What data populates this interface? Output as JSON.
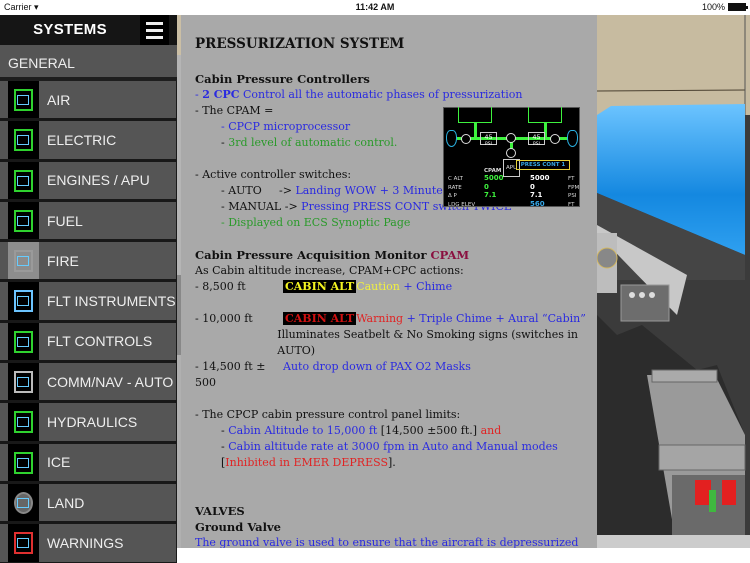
{
  "status_bar": {
    "carrier": "Carrier",
    "wifi_icon": "wifi-icon",
    "time": "11:42 AM",
    "battery": "100%",
    "battery_icon": "battery-icon"
  },
  "sidebar": {
    "title": "SYSTEMS",
    "menu_icon": "hamburger-menu-icon",
    "general_label": "GENERAL",
    "items": [
      {
        "label": "AIR",
        "icon": "air-system-thumbnail-icon"
      },
      {
        "label": "ELECTRIC",
        "icon": "electric-system-thumbnail-icon"
      },
      {
        "label": "ENGINES / APU",
        "icon": "engines-apu-thumbnail-icon"
      },
      {
        "label": "FUEL",
        "icon": "fuel-system-thumbnail-icon"
      },
      {
        "label": "FIRE",
        "icon": "fire-system-thumbnail-icon"
      },
      {
        "label": "FLT INSTRUMENTS",
        "icon": "flight-instruments-thumbnail-icon"
      },
      {
        "label": "FLT CONTROLS",
        "icon": "flight-controls-thumbnail-icon"
      },
      {
        "label": "COMM/NAV - AUTO",
        "icon": "comm-nav-thumbnail-icon"
      },
      {
        "label": "HYDRAULICS",
        "icon": "hydraulics-thumbnail-icon"
      },
      {
        "label": "ICE",
        "icon": "ice-thumbnail-icon"
      },
      {
        "label": "LAND",
        "icon": "landing-gear-thumbnail-icon"
      },
      {
        "label": "WARNINGS",
        "icon": "warnings-thumbnail-icon"
      }
    ]
  },
  "content": {
    "title": "PRESSURIZATION SYSTEM",
    "cpc_section": {
      "heading": "Cabin Pressure Controllers",
      "line1_prefix": "- ",
      "line1_bold": "2 CPC",
      "line1_rest": " Control all the automatic phases of pressurization",
      "line2": "- The CPAM =",
      "line3": "- CPCP microprocessor",
      "line4": "- 3rd level of automatic control.",
      "switches_label": "- Active controller switches:",
      "auto_key": "- AUTO",
      "auto_arrow": "->",
      "auto_value": "Landing WOW + 3 Minutes",
      "manual_key": "- MANUAL",
      "manual_arrow": "->",
      "manual_value": "Pressing PRESS CONT switch TWICE",
      "ecs_note": "- Displayed on ECS Synoptic Page"
    },
    "ecs_display": {
      "psi_left": "45",
      "psi_right": "45",
      "psi_unit": "PSI",
      "apu": "APU",
      "cpam_label": "CPAM",
      "press_cont": "PRESS CONT 1",
      "rows": [
        {
          "label": "C ALT",
          "cpam": "5000",
          "cont": "5000",
          "unit": "FT"
        },
        {
          "label": "RATE",
          "cpam": "0",
          "cont": "0",
          "unit": "FPM"
        },
        {
          "label": "Δ P",
          "cpam": "7.1",
          "cont": "7.1",
          "unit": "PSI"
        },
        {
          "label": "LDG ELEV",
          "cpam": "",
          "cont": "560",
          "unit": "FT"
        }
      ]
    },
    "cpam_section": {
      "heading": "Cabin Pressure Acquisition Monitor ",
      "heading_highlight": "CPAM",
      "intro": "As Cabin altitude increase, CPAM+CPC actions:",
      "r1_key": "- 8,500 ft",
      "r1_tag": "CABIN ALT",
      "r1_level": "Caution",
      "r1_rest": " + Chime",
      "r2_key": "- 10,000 ft",
      "r2_tag": "CABIN ALT",
      "r2_level": "Warning",
      "r2_rest": " + Triple Chime + Aural “Cabin”",
      "r2_note": "Illuminates Seatbelt & No Smoking signs (switches in AUTO)",
      "r3_key": "- 14,500 ft ± 500",
      "r3_value": "Auto drop down of PAX O2 Masks"
    },
    "limits_section": {
      "intro": "- The CPCP cabin pressure control panel limits:",
      "l1_dash": "- ",
      "l1_blue": "Cabin Altitude to 15,000 ft",
      "l1_black": " [14,500 ±500 ft.] ",
      "l1_red": "and",
      "l2_dash": "- ",
      "l2_blue": "Cabin altitude rate at 3000 fpm in Auto and Manual modes",
      "l2_black": " [",
      "l2_red": "Inhibited in EMER DEPRESS",
      "l2_end": "]."
    },
    "valves_section": {
      "heading": "VALVES",
      "subheading": "Ground Valve",
      "text": "The ground valve is used to ensure that the aircraft is depressurized when on the ground to avoid any overpressure."
    }
  },
  "cockpit_image": {
    "icon": "cockpit-illustration-image"
  }
}
